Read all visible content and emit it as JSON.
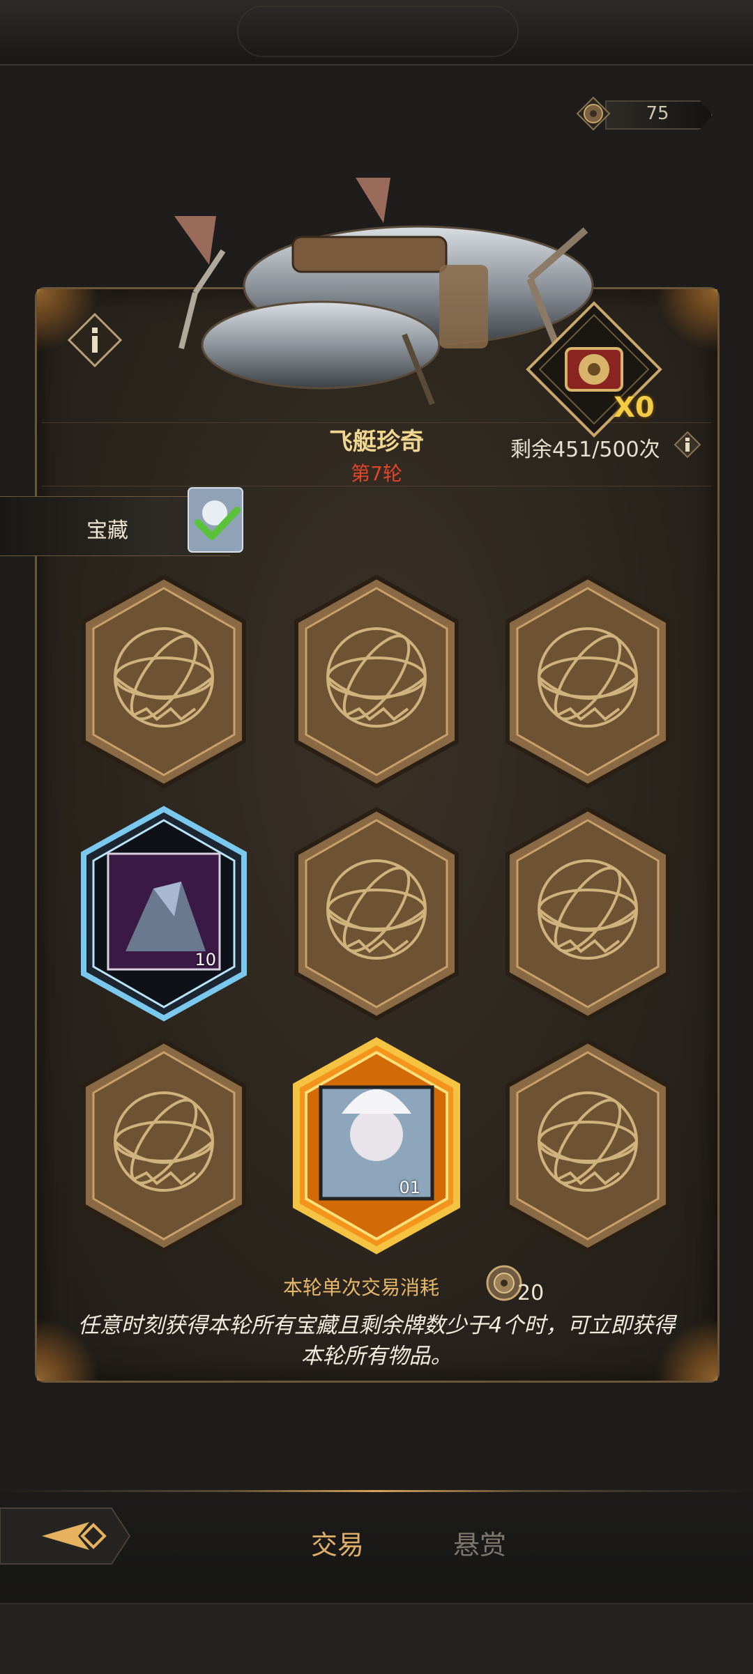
{
  "currency": {
    "value": "75",
    "icon": "gear-coin-icon"
  },
  "event": {
    "title": "飞艇珍奇",
    "round": "第7轮",
    "chest_count": "X0",
    "remaining": "剩余451/500次"
  },
  "tab": {
    "label": "宝藏"
  },
  "cards": [
    {
      "state": "hidden"
    },
    {
      "state": "hidden"
    },
    {
      "state": "hidden"
    },
    {
      "state": "revealed",
      "item": "crystal-ore",
      "quantity": "10"
    },
    {
      "state": "hidden"
    },
    {
      "state": "hidden"
    },
    {
      "state": "hidden"
    },
    {
      "state": "revealed-treasure",
      "item": "hero-portrait",
      "quantity": "01"
    },
    {
      "state": "hidden"
    }
  ],
  "cost": {
    "label": "本轮单次交易消耗",
    "value": "20"
  },
  "description": "任意时刻获得本轮所有宝藏且剩余牌数少于4个时，可立即获得本轮所有物品。",
  "nav": {
    "trade": "交易",
    "bounty": "悬赏"
  },
  "colors": {
    "accent": "#e0b06a",
    "round": "#e0462c",
    "chest_count": "#f2cc46"
  }
}
